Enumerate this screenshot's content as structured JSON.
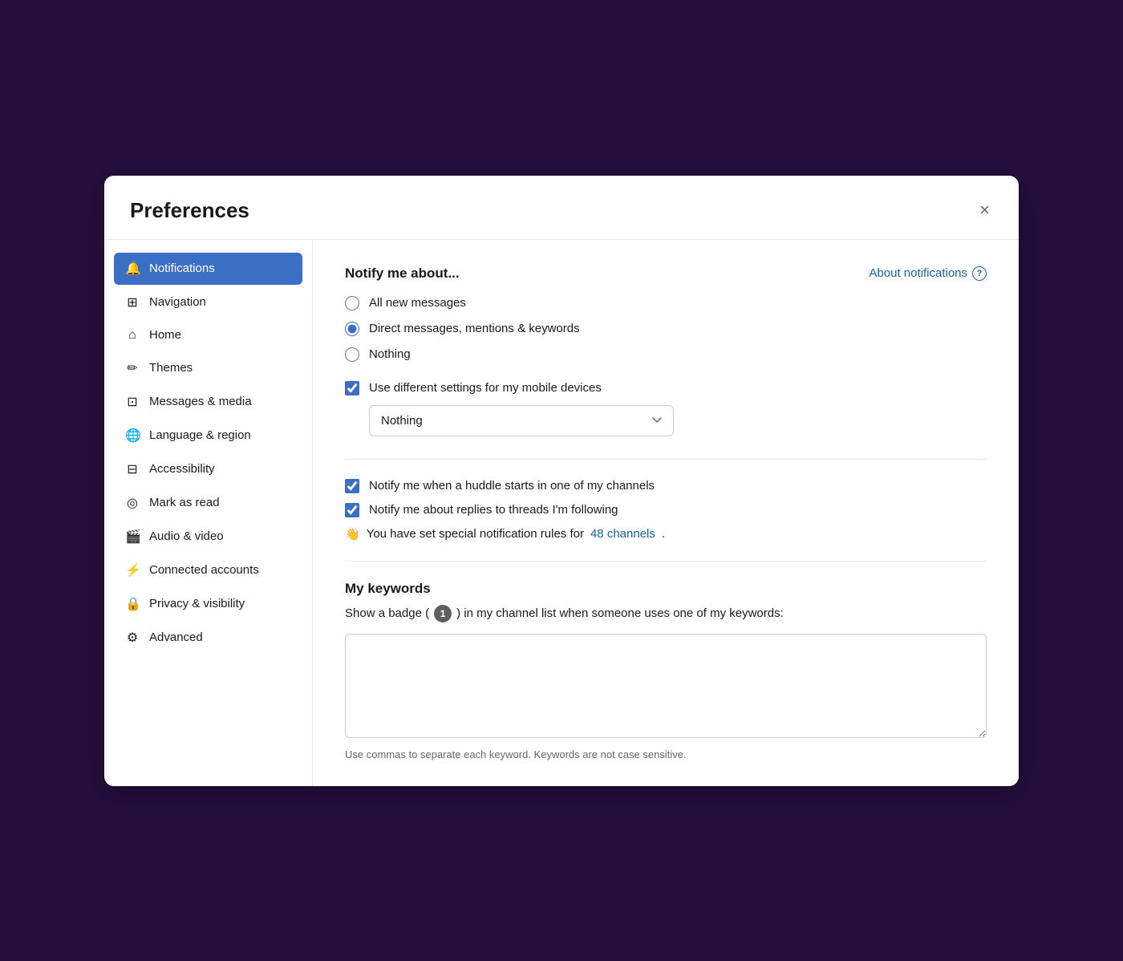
{
  "modal": {
    "title": "Preferences",
    "close_label": "×"
  },
  "sidebar": {
    "items": [
      {
        "id": "notifications",
        "label": "Notifications",
        "icon": "🔔",
        "active": true
      },
      {
        "id": "navigation",
        "label": "Navigation",
        "icon": "⊞"
      },
      {
        "id": "home",
        "label": "Home",
        "icon": "⌂"
      },
      {
        "id": "themes",
        "label": "Themes",
        "icon": "✏"
      },
      {
        "id": "messages-media",
        "label": "Messages & media",
        "icon": "⊡"
      },
      {
        "id": "language-region",
        "label": "Language & region",
        "icon": "🌐"
      },
      {
        "id": "accessibility",
        "label": "Accessibility",
        "icon": "⊟"
      },
      {
        "id": "mark-as-read",
        "label": "Mark as read",
        "icon": "⊙"
      },
      {
        "id": "audio-video",
        "label": "Audio & video",
        "icon": "⊡"
      },
      {
        "id": "connected-accounts",
        "label": "Connected accounts",
        "icon": "⚡"
      },
      {
        "id": "privacy-visibility",
        "label": "Privacy & visibility",
        "icon": "🔒"
      },
      {
        "id": "advanced",
        "label": "Advanced",
        "icon": "⚙"
      }
    ]
  },
  "content": {
    "notify_section": {
      "title": "Notify me about...",
      "about_link": "About notifications",
      "options": [
        {
          "id": "all-new-messages",
          "label": "All new messages",
          "checked": false
        },
        {
          "id": "direct-messages",
          "label": "Direct messages, mentions & keywords",
          "checked": true
        },
        {
          "id": "nothing",
          "label": "Nothing",
          "checked": false
        }
      ]
    },
    "mobile_section": {
      "checkbox_label": "Use different settings for my mobile devices",
      "checked": true,
      "dropdown_value": "Nothing",
      "dropdown_options": [
        "All new messages",
        "Direct messages, mentions & keywords",
        "Nothing"
      ]
    },
    "huddle_checkbox": {
      "label": "Notify me when a huddle starts in one of my channels",
      "checked": true
    },
    "threads_checkbox": {
      "label": "Notify me about replies to threads I'm following",
      "checked": true
    },
    "special_rules": {
      "wave_emoji": "👋",
      "text_before": "You have set special notification rules for",
      "link_text": "48 channels",
      "text_after": "."
    },
    "keywords_section": {
      "title": "My keywords",
      "badge_text_before": "Show a badge (",
      "badge_number": "1",
      "badge_text_after": ") in my channel list when someone uses one of my keywords:",
      "textarea_value": "",
      "hint": "Use commas to separate each keyword. Keywords are not case sensitive."
    }
  }
}
